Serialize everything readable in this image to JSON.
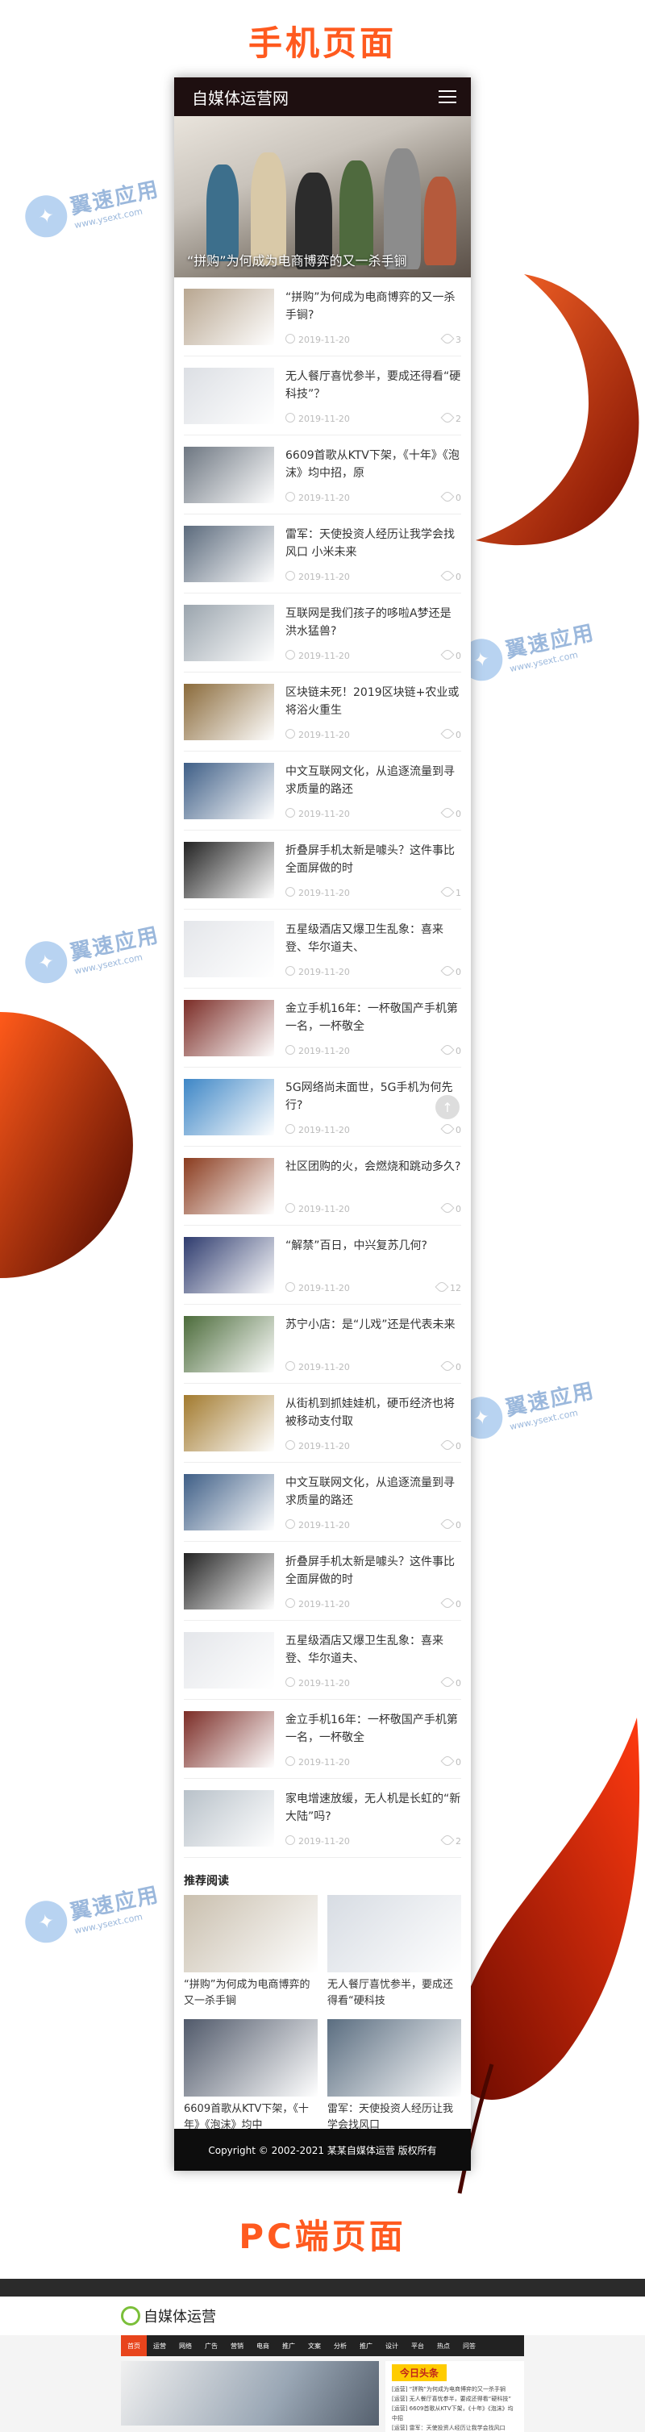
{
  "headings": {
    "mobile": "手机页面",
    "pc": "PC端页面"
  },
  "watermark": {
    "title": "翼速应用",
    "url": "www.ysext.com"
  },
  "colors": {
    "accent": "#ff5a1f",
    "header": "#1e0f10",
    "footer": "#0d0d0d"
  },
  "phone": {
    "brand": "自媒体运营网",
    "hero_caption": "“拼购”为何成为电商博弈的又一杀手锏",
    "articles": [
      {
        "title": "“拼购”为何成为电商博弈的又一杀手锏?",
        "date": "2019-11-20",
        "views": "3"
      },
      {
        "title": "无人餐厅喜忧参半，要成还得看“硬科技”？",
        "date": "2019-11-20",
        "views": "2"
      },
      {
        "title": "6609首歌从KTV下架，《十年》《泡沫》均中招，原",
        "date": "2019-11-20",
        "views": "0"
      },
      {
        "title": "雷军：天使投资人经历让我学会找风口 小米未来",
        "date": "2019-11-20",
        "views": "0"
      },
      {
        "title": "互联网是我们孩子的哆啦A梦还是洪水猛兽?",
        "date": "2019-11-20",
        "views": "0"
      },
      {
        "title": "区块链未死！2019区块链+农业或将浴火重生",
        "date": "2019-11-20",
        "views": "0"
      },
      {
        "title": "中文互联网文化，从追逐流量到寻求质量的路还",
        "date": "2019-11-20",
        "views": "0"
      },
      {
        "title": "折叠屏手机太新是噱头？这件事比全面屏做的时",
        "date": "2019-11-20",
        "views": "1"
      },
      {
        "title": "五星级酒店又爆卫生乱象：喜来登、华尔道夫、",
        "date": "2019-11-20",
        "views": "0"
      },
      {
        "title": "金立手机16年：一杯敬国产手机第一名，一杯敬全",
        "date": "2019-11-20",
        "views": "0"
      },
      {
        "title": "5G网络尚未面世，5G手机为何先行?",
        "date": "2019-11-20",
        "views": "0"
      },
      {
        "title": "社区团购的火，会燃烧和跳动多久?",
        "date": "2019-11-20",
        "views": "0"
      },
      {
        "title": "“解禁”百日，中兴复苏几何?",
        "date": "2019-11-20",
        "views": "12"
      },
      {
        "title": "苏宁小店：是“儿戏”还是代表未来",
        "date": "2019-11-20",
        "views": "0"
      },
      {
        "title": "从街机到抓娃娃机，硬币经济也将被移动支付取",
        "date": "2019-11-20",
        "views": "0"
      },
      {
        "title": "中文互联网文化，从追逐流量到寻求质量的路还",
        "date": "2019-11-20",
        "views": "0"
      },
      {
        "title": "折叠屏手机太新是噱头？这件事比全面屏做的时",
        "date": "2019-11-20",
        "views": "0"
      },
      {
        "title": "五星级酒店又爆卫生乱象：喜来登、华尔道夫、",
        "date": "2019-11-20",
        "views": "0"
      },
      {
        "title": "金立手机16年：一杯敬国产手机第一名，一杯敬全",
        "date": "2019-11-20",
        "views": "0"
      },
      {
        "title": "家电增速放缓，无人机是长虹的“新大陆”吗?",
        "date": "2019-11-20",
        "views": "2"
      }
    ],
    "recommend_title": "推荐阅读",
    "recommend": [
      {
        "title": "“拼购”为何成为电商博弈的又一杀手锏"
      },
      {
        "title": "无人餐厅喜忧参半，要成还得看“硬科技"
      },
      {
        "title": "6609首歌从KTV下架，《十年》《泡沫》均中"
      },
      {
        "title": "雷军：天使投资人经历让我学会找风口"
      }
    ],
    "footer": "Copyright © 2002-2021 某某自媒体运营 版权所有"
  },
  "pc": {
    "logo": "自媒体运营",
    "nav": [
      "首页",
      "运营",
      "网络",
      "广告",
      "营销",
      "电商",
      "推广",
      "文案",
      "分析",
      "推广",
      "设计",
      "平台",
      "热点",
      "问答"
    ],
    "side_title": "今日头条",
    "side_items": [
      "[运营] “拼购”为何成为电商博弈的又一杀手锏",
      "[运营] 无人餐厅喜忧参半，要成还得看“硬科技”",
      "[运营] 6609首歌从KTV下架，《十年》《泡沫》均中招",
      "[运营] 雷军：天使投资人经历让我学会找风口"
    ]
  }
}
